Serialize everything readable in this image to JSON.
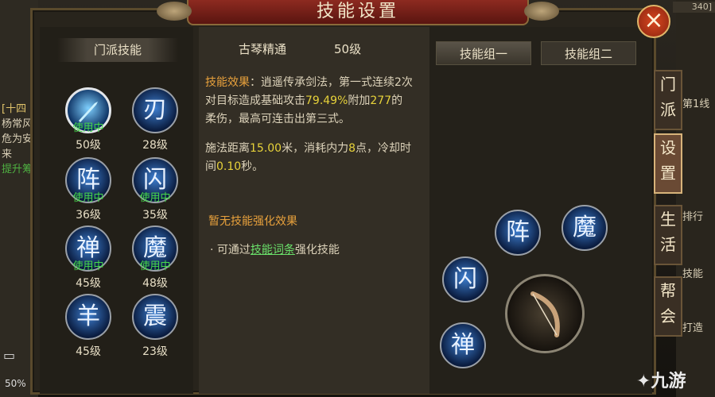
{
  "title": "技能设置",
  "close_icon": "×",
  "background": {
    "left_texts": [
      "[十四",
      "杨常风",
      "危为安",
      "来",
      "提升筹"
    ],
    "battery_pct": "50%",
    "top_right_tag": "340]",
    "right_texts": [
      "第1线",
      "排行",
      "技能",
      "打造"
    ]
  },
  "left_section": {
    "header": "门派技能",
    "skills": [
      {
        "icon": "sword-icon",
        "glyph": "",
        "level": "50级",
        "in_use": "使用中",
        "selected": true
      },
      {
        "icon": "blade-icon",
        "glyph": "刃",
        "level": "28级",
        "in_use": ""
      },
      {
        "icon": "formation-icon",
        "glyph": "阵",
        "level": "36级",
        "in_use": "使用中"
      },
      {
        "icon": "flash-icon",
        "glyph": "闪",
        "level": "35级",
        "in_use": "使用中"
      },
      {
        "icon": "zen-icon",
        "glyph": "禅",
        "level": "45级",
        "in_use": "使用中"
      },
      {
        "icon": "demon-icon",
        "glyph": "魔",
        "level": "48级",
        "in_use": "使用中"
      },
      {
        "icon": "sheep-icon",
        "glyph": "羊",
        "level": "45级",
        "in_use": ""
      },
      {
        "icon": "quake-icon",
        "glyph": "震",
        "level": "23级",
        "in_use": ""
      }
    ]
  },
  "middle_section": {
    "skill_name": "古琴精通",
    "skill_level": "50级",
    "effect_label": "技能效果",
    "effect_text_a": "：逍遥传承剑法，第一式连续2次对目标造成基础攻击",
    "effect_pct": "79.49%",
    "effect_text_b": "附加",
    "effect_num": "277",
    "effect_text_c": "的柔伤，最高可连击出第三式。",
    "range_text_a": "施法距离",
    "range_val": "15.00",
    "range_text_b": "米，消耗内力",
    "cost_val": "8",
    "range_text_c": "点，冷却时间",
    "cd_val": "0.10",
    "range_text_d": "秒。",
    "no_enhance": "暂无技能强化效果",
    "tip_prefix": "· 可通过",
    "tip_link": "技能词条",
    "tip_suffix": "强化技能"
  },
  "right_section": {
    "group_one": "技能组一",
    "group_two": "技能组二",
    "wheel_slots": [
      {
        "icon": "formation-icon",
        "glyph": "阵"
      },
      {
        "icon": "demon-icon",
        "glyph": "魔"
      },
      {
        "icon": "flash-icon",
        "glyph": "闪"
      },
      {
        "icon": "zen-icon",
        "glyph": "禅"
      }
    ],
    "main_weapon": "bow-icon"
  },
  "side_tabs": [
    {
      "label": "门派"
    },
    {
      "label": "设置",
      "active": true
    },
    {
      "label": "生活"
    },
    {
      "label": "帮会"
    }
  ],
  "watermark": "九游"
}
